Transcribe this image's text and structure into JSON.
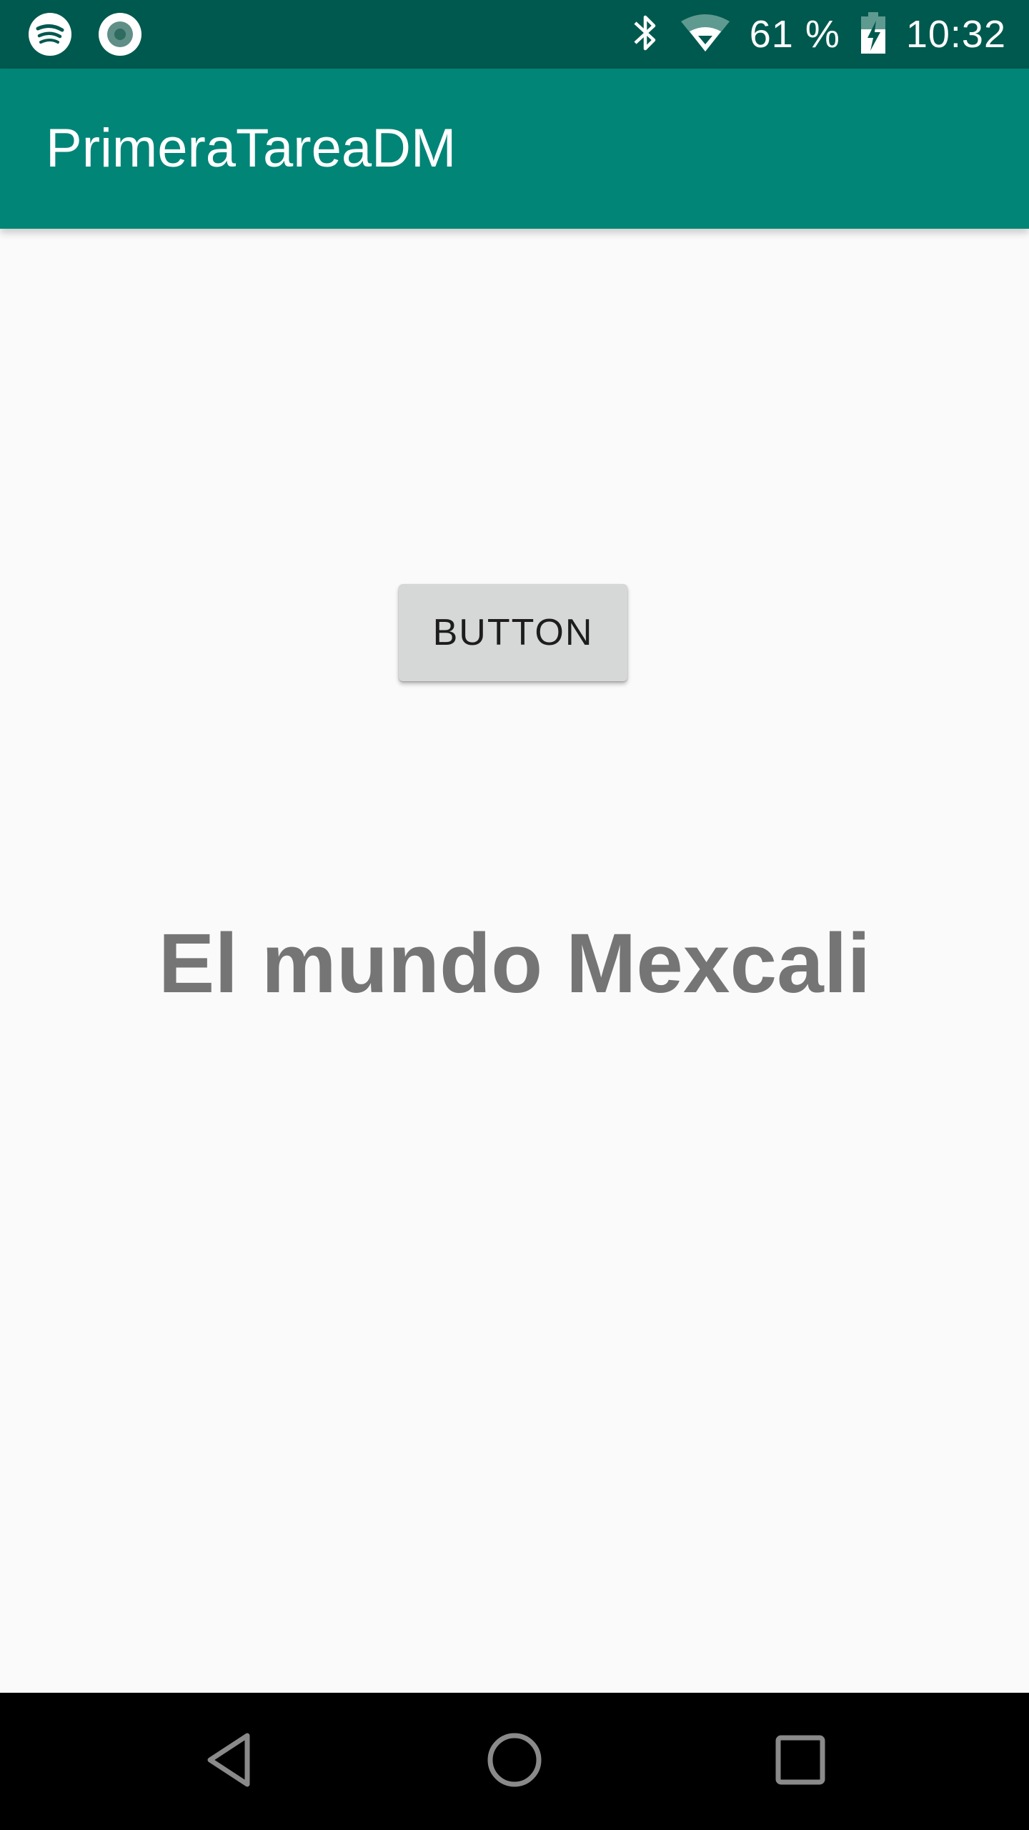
{
  "status_bar": {
    "left_icons": [
      "spotify-icon",
      "record-icon"
    ],
    "battery": "61 %",
    "time": "10:32",
    "right_icons": [
      "bluetooth-icon",
      "wifi-icon",
      "battery-charging-icon"
    ]
  },
  "app_bar": {
    "title": "PrimeraTareaDM",
    "color": "#008577"
  },
  "main": {
    "button_label": "BUTTON",
    "headline": "El mundo Mexcali"
  },
  "nav_bar": {
    "buttons": [
      "back-icon",
      "home-icon",
      "recents-icon"
    ]
  },
  "colors": {
    "status_bar": "#00594e",
    "app_bar": "#008577",
    "background": "#fafafa",
    "button": "#d6d7d7",
    "headline_text": "#757575"
  }
}
